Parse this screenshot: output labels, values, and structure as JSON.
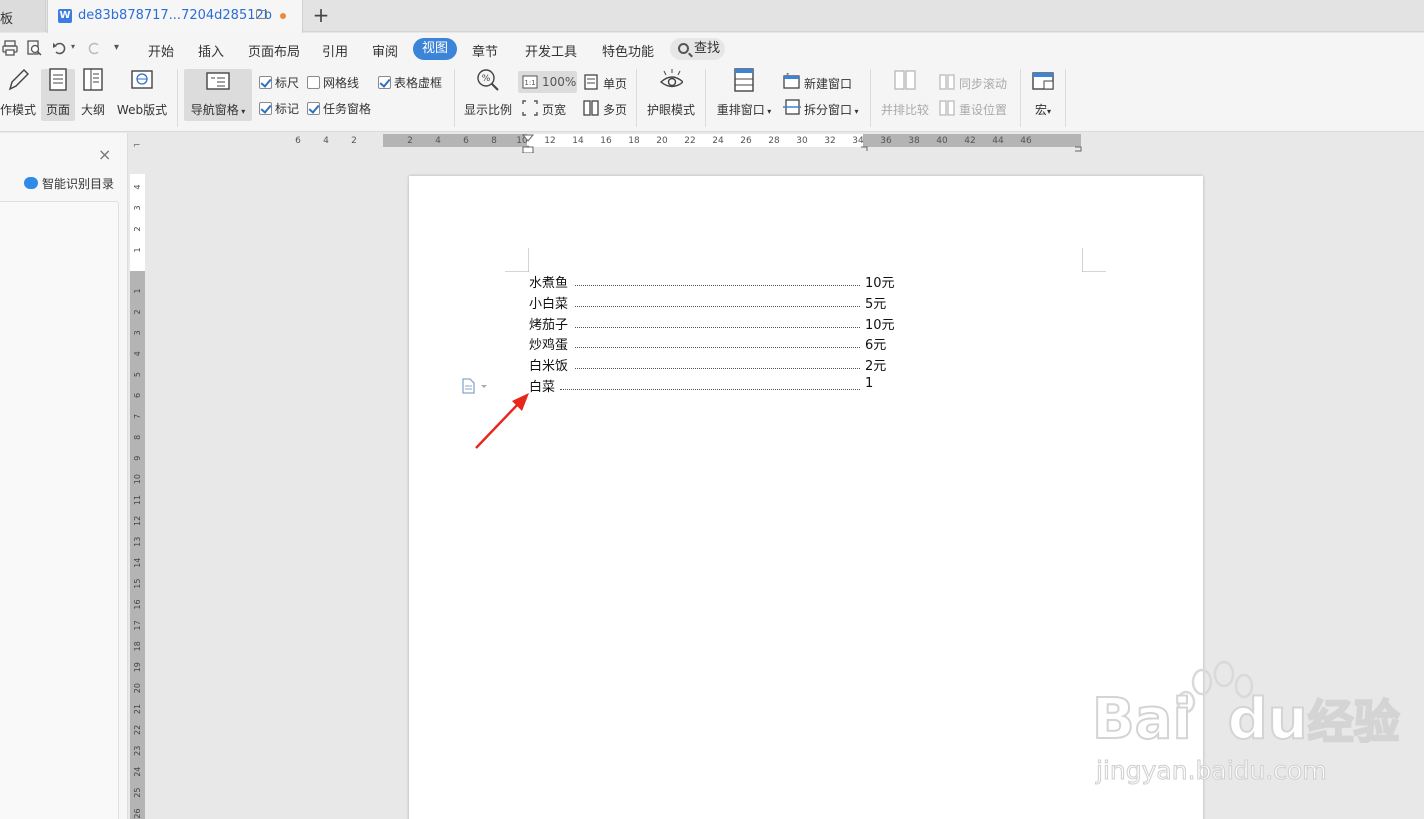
{
  "tabs": {
    "prev_tab": "板",
    "doc_tab": "de83b878717...7204d28512b",
    "doc_icon": "W",
    "new_tab": "+"
  },
  "menu": {
    "items": [
      "开始",
      "插入",
      "页面布局",
      "引用",
      "审阅",
      "视图",
      "章节",
      "开发工具",
      "特色功能"
    ],
    "active": "视图",
    "search": "查找"
  },
  "ribbon": {
    "write_mode": "作模式",
    "page_view": "页面",
    "outline": "大纲",
    "web_layout": "Web版式",
    "nav_pane": "导航窗格",
    "ruler": "标尺",
    "gridlines": "网格线",
    "table_gridlines": "表格虚框",
    "markup": "标记",
    "task_pane": "任务窗格",
    "zoom": "显示比例",
    "zoom_100": "100%",
    "page_width": "页宽",
    "single_page": "单页",
    "multi_page": "多页",
    "eye_mode": "护眼模式",
    "arrange": "重排窗口",
    "new_window": "新建窗口",
    "split_window": "拆分窗口",
    "side_by_side": "并排比较",
    "sync_scroll": "同步滚动",
    "reset_position": "重设位置",
    "macro": "宏"
  },
  "nav_panel": {
    "close": "×",
    "smart_toc": "智能识别目录"
  },
  "ruler": {
    "horizontal": [
      "6",
      "4",
      "2",
      "2",
      "4",
      "6",
      "8",
      "10",
      "12",
      "14",
      "16",
      "18",
      "20",
      "22",
      "24",
      "26",
      "28",
      "30",
      "32",
      "34",
      "36",
      "38",
      "40",
      "42",
      "44",
      "46"
    ],
    "vertical": [
      "4",
      "3",
      "2",
      "1",
      "1",
      "2",
      "3",
      "4",
      "5",
      "6",
      "7",
      "8",
      "9",
      "10",
      "11",
      "12",
      "13",
      "14",
      "15",
      "16",
      "17",
      "18",
      "19",
      "20",
      "21",
      "22",
      "23",
      "24",
      "25",
      "26"
    ]
  },
  "document": {
    "toc": [
      {
        "title": "水煮鱼",
        "page": "10元"
      },
      {
        "title": "小白菜",
        "page": "5元"
      },
      {
        "title": "烤茄子",
        "page": "10元"
      },
      {
        "title": "炒鸡蛋",
        "page": "6元"
      },
      {
        "title": "白米饭",
        "page": "2元"
      },
      {
        "title": "白菜",
        "page": "1"
      }
    ]
  },
  "watermark": {
    "brand": "Bai",
    "brand2": "du",
    "cn": "经验",
    "url": "jingyan.baidu.com"
  },
  "colors": {
    "accent": "#3c84d8",
    "arrow": "#e8261c"
  }
}
